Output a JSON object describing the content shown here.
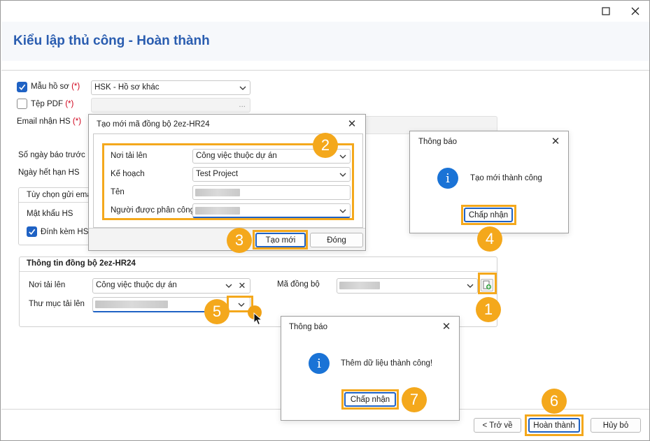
{
  "window": {
    "maximize_glyph": "☐",
    "close_glyph": "✕"
  },
  "page": {
    "title": "Kiểu lập thủ công - Hoàn thành"
  },
  "form": {
    "mau_ho_so_label": "Mẫu hồ sơ",
    "mau_ho_so_value": "HSK - Hồ sơ khác",
    "tep_pdf_label": "Tệp PDF",
    "tep_pdf_dots": "...",
    "email_label": "Email nhận HS",
    "required_mark": "(*)",
    "so_ngay_label": "Số ngày báo trước",
    "ngay_het_han_label": "Ngày hết hạn HS",
    "tuy_chon_label": "Tùy chọn gửi ema",
    "mat_khau_label": "Mật khẩu HS",
    "dinh_kem_label": "Đính kèm HS"
  },
  "sync": {
    "title": "Thông tin đồng bộ 2ez-HR24",
    "noi_tai_len_label": "Nơi tải lên",
    "noi_tai_len_value": "Công việc thuộc dự án",
    "thu_muc_label": "Thư mục tải lên",
    "ma_dong_bo_label": "Mã đồng bộ"
  },
  "create_dialog": {
    "title": "Tạo mới mã đồng bộ 2ez-HR24",
    "noi_tai_len_label": "Nơi tải lên",
    "noi_tai_len_value": "Công việc thuộc dự án",
    "ke_hoach_label": "Kế hoạch",
    "ke_hoach_value": "Test Project",
    "ten_label": "Tên",
    "nguoi_label": "Người được phân công",
    "create_button": "Tạo mới",
    "close_button": "Đóng"
  },
  "notice1": {
    "title": "Thông báo",
    "message": "Tạo mới thành công",
    "ok_button": "Chấp nhận"
  },
  "notice2": {
    "title": "Thông báo",
    "message": "Thêm dữ liệu thành công!",
    "ok_button": "Chấp nhận"
  },
  "footer": {
    "back_button": "< Trở về",
    "finish_button": "Hoàn thành",
    "cancel_button": "Hủy bỏ"
  },
  "steps": [
    "1",
    "2",
    "3",
    "4",
    "5",
    "6",
    "7"
  ],
  "colors": {
    "accent_blue": "#1f62c4",
    "title_blue": "#2a5db0",
    "highlight_orange": "#f4a81c",
    "required_red": "#d0021b",
    "info_blue": "#1a73d6"
  }
}
